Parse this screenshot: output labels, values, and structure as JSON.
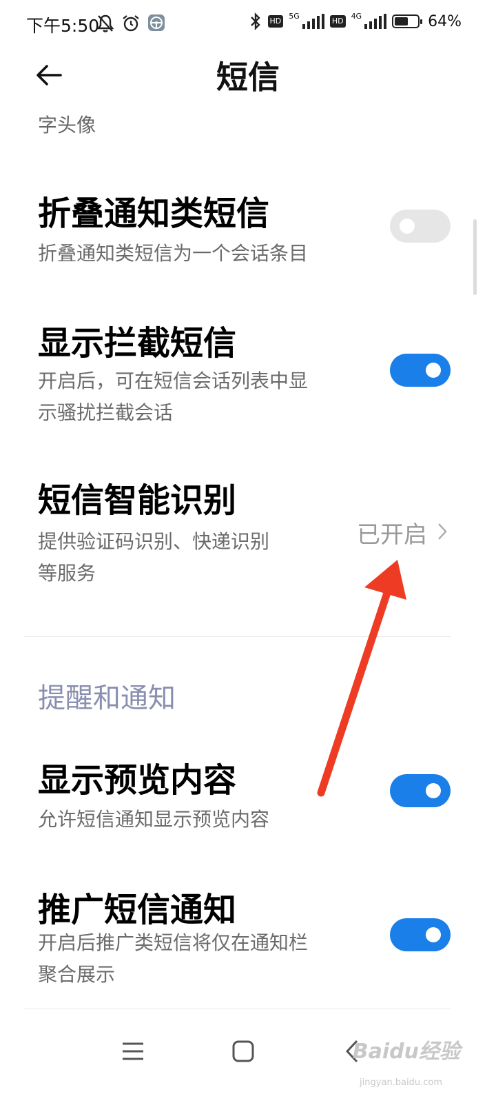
{
  "status_bar": {
    "time": "下午5:50",
    "battery_percent": "64%",
    "battery_level": 0.64,
    "hd1": "HD",
    "hd2": "HD",
    "net1": "5G",
    "net2": "4G"
  },
  "header": {
    "title": "短信"
  },
  "partial_item": {
    "text": "字头像"
  },
  "settings": [
    {
      "title": "折叠通知类短信",
      "desc_lines": [
        "折叠通知类短信为一个会话条目"
      ],
      "toggle": "off"
    },
    {
      "title": "显示拦截短信",
      "desc_lines": [
        "开启后，可在短信会话列表中显",
        "示骚扰拦截会话"
      ],
      "toggle": "on"
    },
    {
      "title": "短信智能识别",
      "desc_lines": [
        "提供验证码识别、快递识别",
        "等服务"
      ],
      "value": "已开启"
    }
  ],
  "section": {
    "title": "提醒和通知"
  },
  "notification_settings": [
    {
      "title": "显示预览内容",
      "desc_lines": [
        "允许短信通知显示预览内容"
      ],
      "toggle": "on"
    },
    {
      "title": "推广短信通知",
      "desc_lines": [
        "开启后推广类短信将仅在通知栏",
        "聚合展示"
      ],
      "toggle": "on"
    }
  ],
  "watermark": {
    "brand": "Baidu经验",
    "url": "jingyan.baidu.com"
  },
  "colors": {
    "toggle_on": "#1a7fe8",
    "toggle_off": "#e6e6e6",
    "section_header": "#8a8fb0",
    "annotation_arrow": "#ee3b24"
  }
}
